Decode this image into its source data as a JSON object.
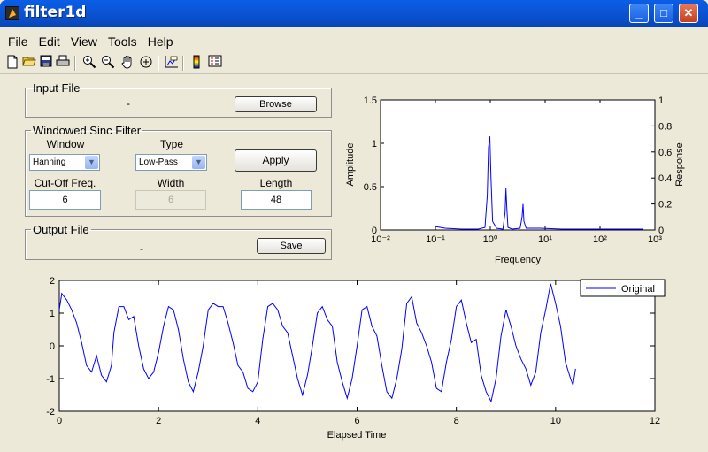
{
  "window": {
    "title": "filter1d",
    "minimize_glyph": "_",
    "maximize_glyph": "□",
    "close_glyph": "✕"
  },
  "menu": [
    "File",
    "Edit",
    "View",
    "Tools",
    "Help"
  ],
  "toolbar_icons": [
    "new-file-icon",
    "open-folder-icon",
    "save-icon",
    "print-icon",
    "zoom-in-icon",
    "zoom-out-icon",
    "pan-hand-icon",
    "rotate-3d-icon",
    "data-cursor-icon",
    "colorbar-icon",
    "legend-icon"
  ],
  "input_file": {
    "legend": "Input File",
    "filename": "-",
    "browse_label": "Browse"
  },
  "filter": {
    "legend": "Windowed Sinc Filter",
    "window_label": "Window",
    "window_value": "Hanning",
    "type_label": "Type",
    "type_value": "Low-Pass",
    "apply_label": "Apply",
    "cutoff_label": "Cut-Off Freq.",
    "cutoff_value": "6",
    "width_label": "Width",
    "width_value": "6",
    "length_label": "Length",
    "length_value": "48"
  },
  "output_file": {
    "legend": "Output File",
    "filename": "-",
    "save_label": "Save"
  },
  "chart_data": [
    {
      "type": "line",
      "xscale": "log",
      "xlabel": "Frequency",
      "ylabel": "Amplitude",
      "y2label": "Response",
      "xlim": [
        0.01,
        1000
      ],
      "ylim": [
        0,
        1.5
      ],
      "y2lim": [
        0,
        1
      ],
      "xticks": [
        "10⁻²",
        "10⁻¹",
        "10⁰",
        "10¹",
        "10²",
        "10³"
      ],
      "yticks": [
        "0",
        "0.5",
        "1",
        "1.5"
      ],
      "y2ticks": [
        "0",
        "0.2",
        "0.4",
        "0.6",
        "0.8",
        "1"
      ],
      "series": [
        {
          "color": "#0000ff",
          "x": [
            0.1,
            0.15,
            0.3,
            0.6,
            0.8,
            0.88,
            0.93,
            0.98,
            1.03,
            1.1,
            1.3,
            1.7,
            1.86,
            1.93,
            2.0,
            2.1,
            2.5,
            3.5,
            3.8,
            3.95,
            4.1,
            4.5,
            8,
            20,
            60,
            200,
            600
          ],
          "y": [
            0.04,
            0.02,
            0.01,
            0.01,
            0.03,
            0.4,
            0.95,
            1.08,
            0.6,
            0.1,
            0.02,
            0.01,
            0.2,
            0.48,
            0.25,
            0.03,
            0.01,
            0.02,
            0.15,
            0.3,
            0.1,
            0.02,
            0.02,
            0.01,
            0.01,
            0.01,
            0.01
          ]
        }
      ]
    },
    {
      "type": "line",
      "xlabel": "Elapsed Time",
      "ylabel": "",
      "xlim": [
        0,
        12
      ],
      "ylim": [
        -2,
        2
      ],
      "xticks": [
        "0",
        "2",
        "4",
        "6",
        "8",
        "10",
        "12"
      ],
      "yticks": [
        "-2",
        "-1",
        "0",
        "1",
        "2"
      ],
      "legend": {
        "position": "top-right",
        "entries": [
          "Original"
        ]
      },
      "series": [
        {
          "name": "Original",
          "color": "#0000ff",
          "x": [
            0,
            0.05,
            0.15,
            0.25,
            0.35,
            0.45,
            0.55,
            0.65,
            0.75,
            0.85,
            0.95,
            1.05,
            1.1,
            1.2,
            1.3,
            1.4,
            1.5,
            1.6,
            1.7,
            1.8,
            1.9,
            2.0,
            2.1,
            2.2,
            2.3,
            2.4,
            2.5,
            2.6,
            2.7,
            2.8,
            2.9,
            3.0,
            3.1,
            3.2,
            3.3,
            3.4,
            3.5,
            3.6,
            3.7,
            3.8,
            3.9,
            4.0,
            4.1,
            4.2,
            4.3,
            4.4,
            4.5,
            4.6,
            4.7,
            4.8,
            4.9,
            5.0,
            5.1,
            5.2,
            5.3,
            5.4,
            5.5,
            5.6,
            5.7,
            5.8,
            5.9,
            6.0,
            6.1,
            6.2,
            6.3,
            6.4,
            6.5,
            6.6,
            6.7,
            6.8,
            6.9,
            7.0,
            7.1,
            7.2,
            7.3,
            7.4,
            7.5,
            7.6,
            7.7,
            7.8,
            7.9,
            8.0,
            8.1,
            8.2,
            8.3,
            8.4,
            8.5,
            8.6,
            8.7,
            8.8,
            8.9,
            9.0,
            9.1,
            9.2,
            9.3,
            9.4,
            9.5,
            9.6,
            9.7,
            9.8,
            9.9,
            10.0,
            10.1,
            10.2,
            10.3,
            10.35,
            10.4
          ],
          "y": [
            1.1,
            1.6,
            1.4,
            1.1,
            0.7,
            0.1,
            -0.6,
            -0.8,
            -0.3,
            -0.9,
            -1.1,
            -0.6,
            0.4,
            1.2,
            1.2,
            0.8,
            0.9,
            0.0,
            -0.7,
            -1.0,
            -0.8,
            -0.2,
            0.6,
            1.2,
            1.1,
            0.5,
            -0.4,
            -1.1,
            -1.4,
            -0.8,
            0.0,
            1.1,
            1.3,
            1.2,
            1.2,
            0.7,
            0.1,
            -0.6,
            -0.8,
            -1.3,
            -1.4,
            -1.1,
            0.2,
            1.2,
            1.3,
            1.1,
            0.6,
            0.4,
            -0.3,
            -1.0,
            -1.5,
            -0.9,
            0.0,
            1.0,
            1.2,
            0.8,
            0.6,
            -0.5,
            -1.1,
            -1.6,
            -1.0,
            0.0,
            1.1,
            1.2,
            0.6,
            0.3,
            -0.6,
            -1.4,
            -1.6,
            -1.0,
            -0.1,
            1.3,
            1.5,
            0.7,
            0.4,
            0.0,
            -0.5,
            -1.3,
            -1.4,
            -0.5,
            0.2,
            1.2,
            1.4,
            0.7,
            0.1,
            0.2,
            -0.9,
            -1.4,
            -1.7,
            -1.0,
            0.3,
            1.1,
            0.6,
            0.0,
            -0.4,
            -0.7,
            -1.2,
            -0.8,
            0.4,
            1.1,
            1.9,
            1.3,
            0.6,
            -0.5,
            -1.0,
            -1.2,
            -0.7
          ]
        }
      ]
    }
  ]
}
